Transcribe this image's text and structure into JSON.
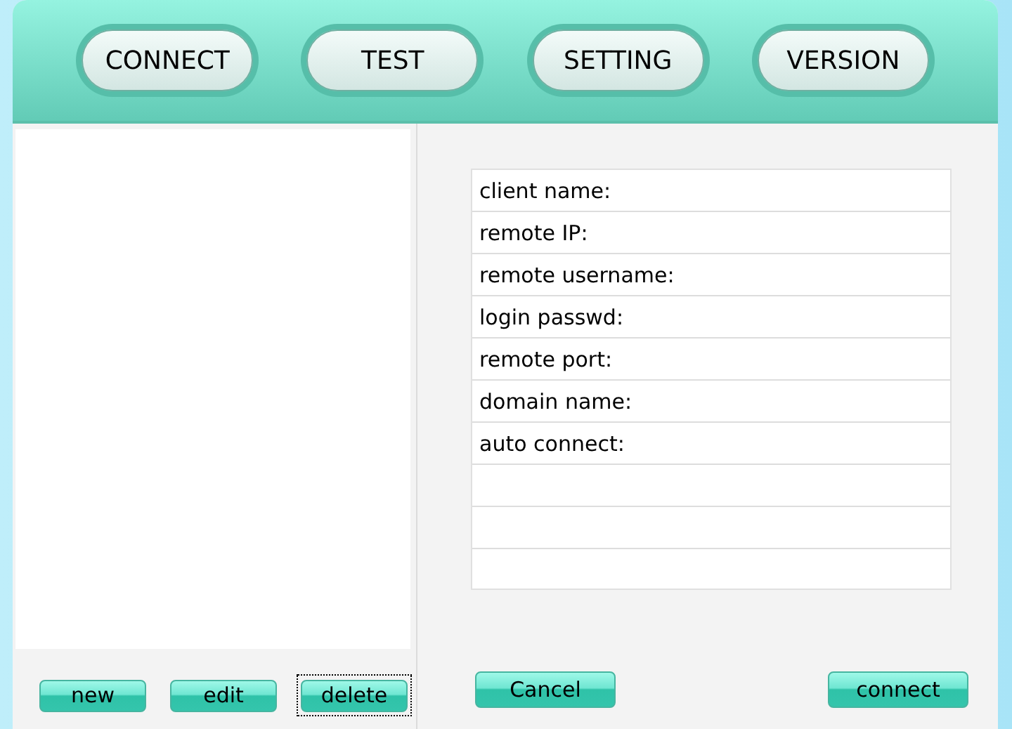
{
  "tabs": [
    {
      "label": "CONNECT"
    },
    {
      "label": "TEST"
    },
    {
      "label": "SETTING"
    },
    {
      "label": "VERSION"
    }
  ],
  "list_buttons": [
    {
      "label": "new",
      "focused": false
    },
    {
      "label": "edit",
      "focused": false
    },
    {
      "label": "delete",
      "focused": true
    }
  ],
  "fields": [
    {
      "label": "client name:"
    },
    {
      "label": "remote IP:"
    },
    {
      "label": "remote username:"
    },
    {
      "label": "login passwd:"
    },
    {
      "label": "remote port:"
    },
    {
      "label": "domain name:"
    },
    {
      "label": "auto connect:"
    }
  ],
  "actions": [
    {
      "label": "Cancel",
      "focused": false
    },
    {
      "label": "connect",
      "focused": false
    }
  ]
}
